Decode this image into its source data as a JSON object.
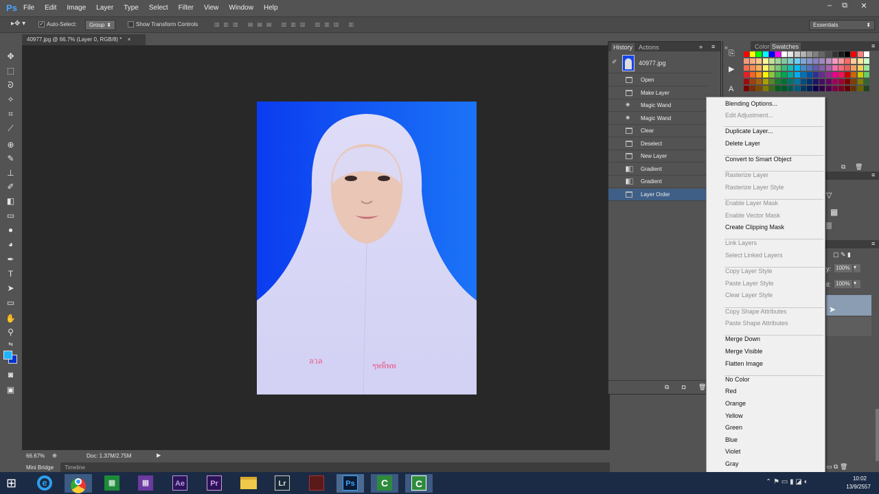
{
  "app": {
    "logo": "Ps"
  },
  "menubar": {
    "items": [
      "File",
      "Edit",
      "Image",
      "Layer",
      "Type",
      "Select",
      "Filter",
      "View",
      "Window",
      "Help"
    ]
  },
  "window_controls": {
    "minimize": "–",
    "restore": "⧉",
    "close": "✕"
  },
  "options_bar": {
    "auto_select_label": "Auto-Select:",
    "auto_select_checked": true,
    "group_value": "Group",
    "show_transform_label": "Show Transform Controls",
    "workspace_value": "Essentials"
  },
  "document": {
    "tab_title": "40977.jpg @ 66.7% (Layer 0, RGB/8) *",
    "close": "×"
  },
  "status": {
    "zoom": "66.67%",
    "doc_size": "Doc: 1.37M/2.75M"
  },
  "bottom_tabs": [
    "Mini Bridge",
    "Timeline"
  ],
  "history_panel": {
    "tabs": [
      "History",
      "Actions"
    ],
    "snapshot_name": "40977.jpg",
    "steps": [
      "Open",
      "Make Layer",
      "Magic Wand",
      "Magic Wand",
      "Clear",
      "Deselect",
      "New Layer",
      "Gradient",
      "Gradient",
      "Layer Order"
    ],
    "selected_index": 9
  },
  "swatch_panel": {
    "tabs": [
      "Color",
      "Swatches"
    ]
  },
  "layers_panel": {
    "opacity_value": "100%",
    "fill_value": "100%"
  },
  "context_menu": {
    "items": [
      {
        "label": "Blending Options...",
        "enabled": true
      },
      {
        "label": "Edit Adjustment...",
        "enabled": false
      },
      {
        "label": "Duplicate Layer...",
        "enabled": true
      },
      {
        "label": "Delete Layer",
        "enabled": true
      },
      {
        "label": "Convert to Smart Object",
        "enabled": true
      },
      {
        "label": "Rasterize Layer",
        "enabled": false
      },
      {
        "label": "Rasterize Layer Style",
        "enabled": false
      },
      {
        "label": "Enable Layer Mask",
        "enabled": false
      },
      {
        "label": "Enable Vector Mask",
        "enabled": false
      },
      {
        "label": "Create Clipping Mask",
        "enabled": true
      },
      {
        "label": "Link Layers",
        "enabled": false
      },
      {
        "label": "Select Linked Layers",
        "enabled": false
      },
      {
        "label": "Copy Layer Style",
        "enabled": false
      },
      {
        "label": "Paste Layer Style",
        "enabled": false
      },
      {
        "label": "Clear Layer Style",
        "enabled": false
      },
      {
        "label": "Copy Shape Attributes",
        "enabled": false
      },
      {
        "label": "Paste Shape Attributes",
        "enabled": false
      },
      {
        "label": "Merge Down",
        "enabled": true
      },
      {
        "label": "Merge Visible",
        "enabled": true
      },
      {
        "label": "Flatten Image",
        "enabled": true
      },
      {
        "label": "No Color",
        "enabled": true
      },
      {
        "label": "Red",
        "enabled": true
      },
      {
        "label": "Orange",
        "enabled": true
      },
      {
        "label": "Yellow",
        "enabled": true
      },
      {
        "label": "Green",
        "enabled": true
      },
      {
        "label": "Blue",
        "enabled": true
      },
      {
        "label": "Violet",
        "enabled": true
      },
      {
        "label": "Gray",
        "enabled": true
      }
    ]
  },
  "taskbar": {
    "apps": [
      "ie-icon",
      "chrome-icon",
      "excel-icon",
      "calendar-icon",
      "after-effects-icon",
      "premiere-icon",
      "file-explorer-icon",
      "lightroom-icon",
      "game-icon",
      "photoshop-icon",
      "camtasia-icon",
      "camtasia-recorder-icon"
    ],
    "app_labels": {
      "ae": "Ae",
      "pr": "Pr",
      "lr": "Lr",
      "ps": "Ps"
    },
    "clock_time": "10:02",
    "clock_date": "13/9/2557"
  },
  "colors": {
    "foreground": "#1fb3ff",
    "background": "#0033cc",
    "photo_bg": "#0b3cf0",
    "accent_selected": "#3f5f87"
  }
}
